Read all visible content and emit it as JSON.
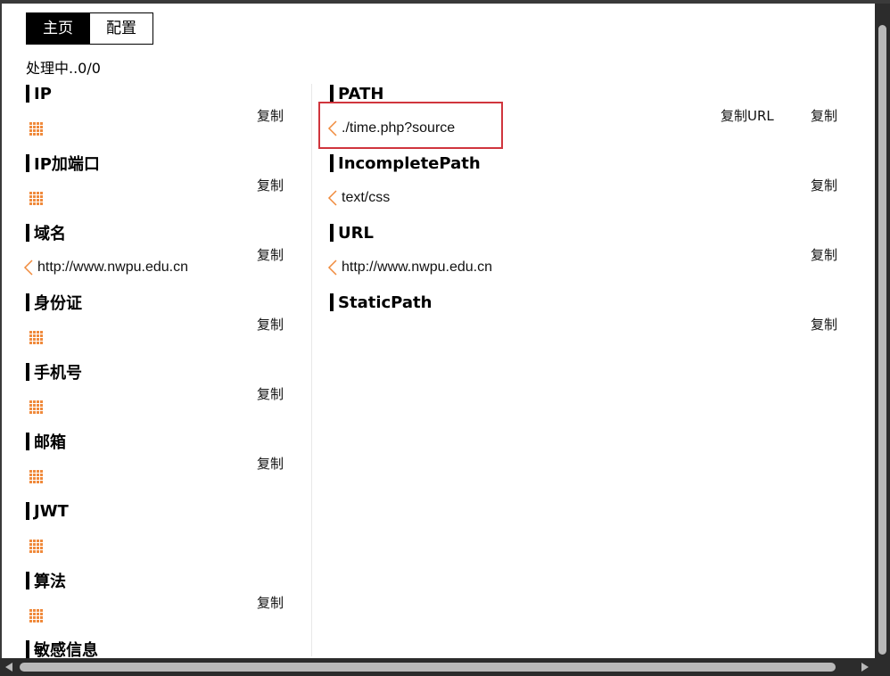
{
  "tabs": [
    {
      "label": "主页",
      "active": true
    },
    {
      "label": "配置",
      "active": false
    }
  ],
  "status": "处理中..0/0",
  "copy_label": "复制",
  "copy_url_label": "复制URL",
  "colors": {
    "accent_orange": "#f08a3c",
    "highlight_red": "#d0353d"
  },
  "icons": {
    "empty": "grid-icon",
    "expand": "chevron-left-icon"
  },
  "left_sections": [
    {
      "title": "IP",
      "item": null
    },
    {
      "title": "IP加端口",
      "item": null
    },
    {
      "title": "域名",
      "item": "http://www.nwpu.edu.cn"
    },
    {
      "title": "身份证",
      "item": null
    },
    {
      "title": "手机号",
      "item": null
    },
    {
      "title": "邮箱",
      "item": null
    },
    {
      "title": "JWT",
      "item": null
    },
    {
      "title": "算法",
      "item": null
    },
    {
      "title": "敏感信息",
      "item": null
    }
  ],
  "right_sections": [
    {
      "title": "PATH",
      "item": "./time.php?source"
    },
    {
      "title": "IncompletePath",
      "item": "text/css"
    },
    {
      "title": "URL",
      "item": "http://www.nwpu.edu.cn"
    },
    {
      "title": "StaticPath",
      "item": null
    }
  ]
}
